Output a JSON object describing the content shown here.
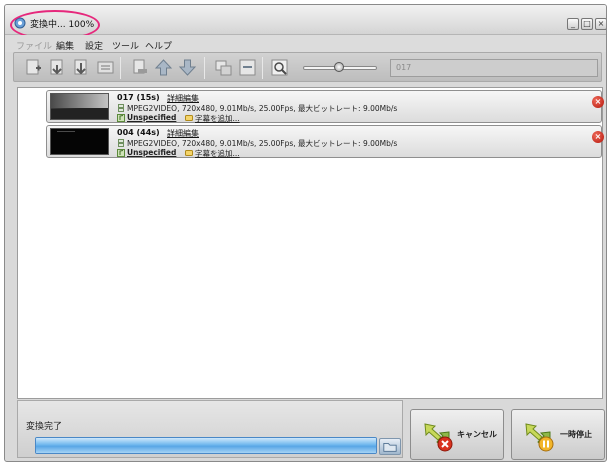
{
  "window": {
    "title": "変換中... 100%",
    "controls": {
      "minimize": "_",
      "maximize": "□",
      "close": "×"
    }
  },
  "menu": {
    "items": [
      "ファイル",
      "編集",
      "設定",
      "ツール",
      "ヘルプ"
    ]
  },
  "toolbar": {
    "buttons": [
      "add-video-icon",
      "add-folder-icon",
      "add-audio-icon",
      "clear-list-icon",
      "remove-item-icon",
      "move-up-icon",
      "move-down-icon",
      "merge-icon",
      "split-icon",
      "preview-icon"
    ],
    "output_name": "017"
  },
  "files": [
    {
      "title": "017 (15s)",
      "edit_link": "詳細編集",
      "info": "MPEG2VIDEO, 720x480, 9.01Mb/s, 25.00Fps, 最大ビットレート: 9.00Mb/s",
      "audio": "Unspecified",
      "subtitle_link": "字幕を追加..."
    },
    {
      "title": "004 (44s)",
      "edit_link": "詳細編集",
      "info": "MPEG2VIDEO, 720x480, 9.01Mb/s, 25.00Fps, 最大ビットレート: 9.00Mb/s",
      "audio": "Unspecified",
      "subtitle_link": "字幕を追加..."
    }
  ],
  "status": {
    "text": "変換完了",
    "progress": 1.0
  },
  "actions": {
    "cancel": "キャンセル",
    "pause": "一時停止"
  },
  "colors": {
    "highlight": "#e6287c",
    "progress": "#58a6e6",
    "close": "#c0200f"
  }
}
